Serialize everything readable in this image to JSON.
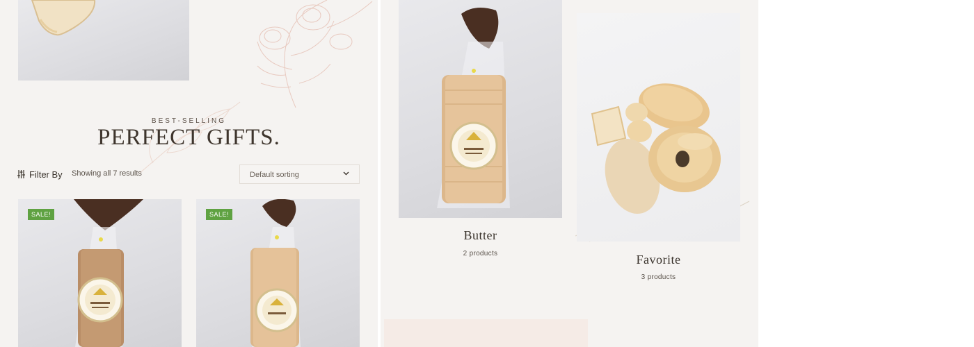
{
  "section": {
    "eyebrow": "BEST-SELLING",
    "title": "PERFECT GIFTS."
  },
  "toolbar": {
    "filter_label": "Filter By",
    "filter_icon": "sliders-icon",
    "results_text": "Showing all 7 results",
    "sort_value": "Default sorting",
    "sort_icon": "chevron-down-icon"
  },
  "products": [
    {
      "badge": "SALE!",
      "image": "whole-wheat-bread-photo"
    },
    {
      "badge": "SALE!",
      "image": "butter-bread-photo"
    }
  ],
  "categories": [
    {
      "title": "Butter",
      "count": "2 products",
      "image": "butter-bread-photo"
    },
    {
      "title": "Favorite",
      "count": "3 products",
      "image": "assorted-bread-photo"
    }
  ],
  "colors": {
    "background": "#f5f3f1",
    "sale_badge": "#5fa242",
    "text": "#3a332c",
    "accent_block": "#f5ebe6"
  }
}
